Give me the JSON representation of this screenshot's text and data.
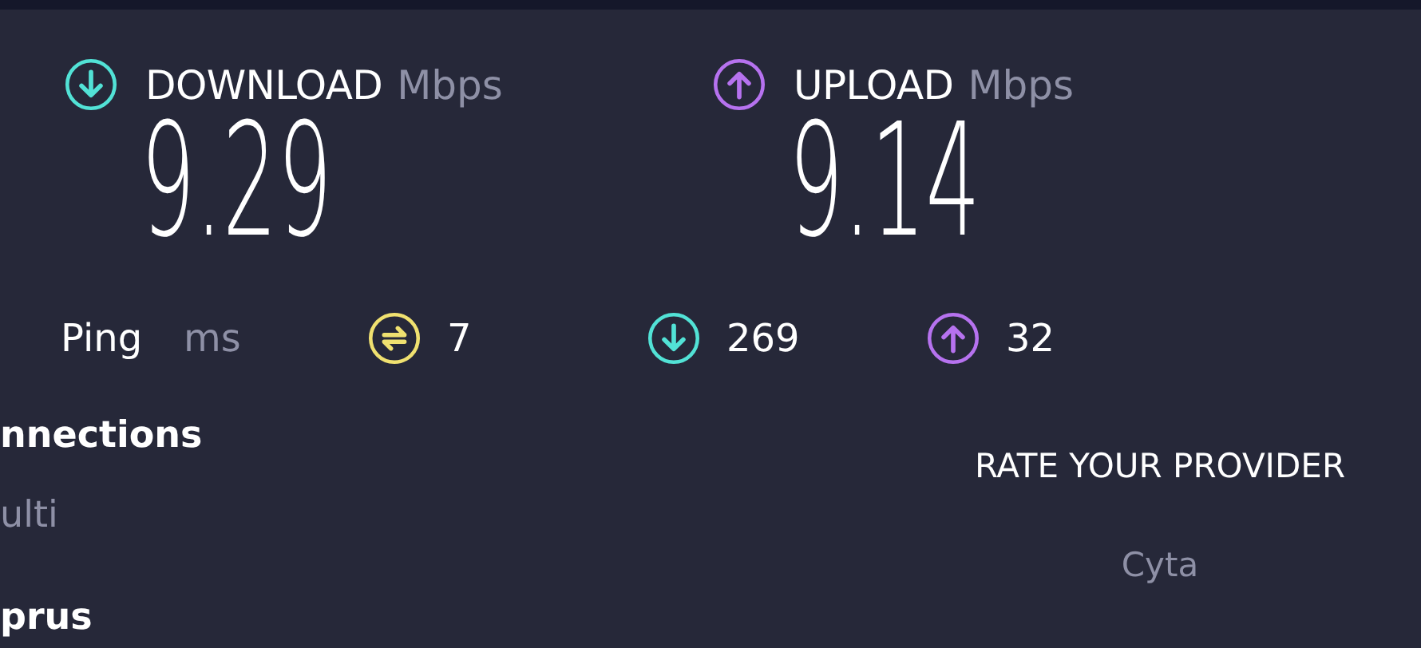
{
  "results": [
    {
      "kind": "download",
      "label": "DOWNLOAD",
      "unit": "Mbps",
      "value": "9.29"
    },
    {
      "kind": "upload",
      "label": "UPLOAD",
      "unit": "Mbps",
      "value": "9.14"
    }
  ],
  "ping": {
    "label": "Ping",
    "unit": "ms",
    "readings": [
      {
        "kind": "idle",
        "value": "7"
      },
      {
        "kind": "download",
        "value": "269"
      },
      {
        "kind": "upload",
        "value": "32"
      }
    ]
  },
  "details": [
    {
      "title": "nnections",
      "value": "ulti"
    },
    {
      "title": "prus"
    }
  ],
  "provider": {
    "heading": "RATE YOUR PROVIDER",
    "name": "Cyta"
  }
}
